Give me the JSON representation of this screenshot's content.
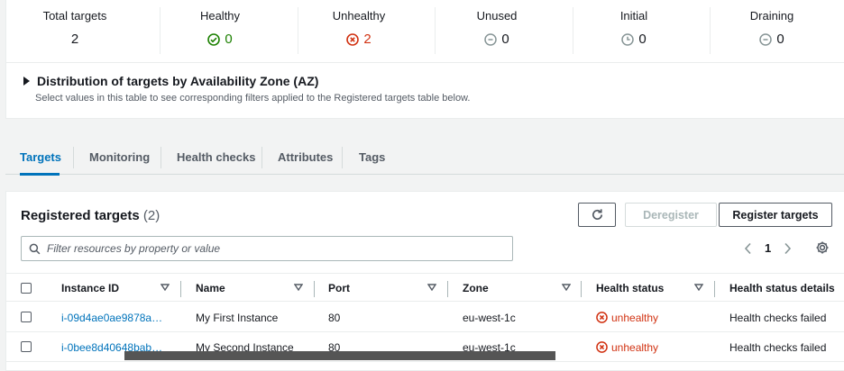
{
  "summary": {
    "total": {
      "label": "Total targets",
      "value": "2"
    },
    "healthy": {
      "label": "Healthy",
      "value": "0"
    },
    "unhealthy": {
      "label": "Unhealthy",
      "value": "2"
    },
    "unused": {
      "label": "Unused",
      "value": "0"
    },
    "initial": {
      "label": "Initial",
      "value": "0"
    },
    "draining": {
      "label": "Draining",
      "value": "0"
    }
  },
  "az": {
    "title": "Distribution of targets by Availability Zone (AZ)",
    "description": "Select values in this table to see corresponding filters applied to the Registered targets table below."
  },
  "tabs": [
    {
      "label": "Targets",
      "active": true
    },
    {
      "label": "Monitoring"
    },
    {
      "label": "Health checks"
    },
    {
      "label": "Attributes"
    },
    {
      "label": "Tags"
    }
  ],
  "registered": {
    "title": "Registered targets",
    "count": "(2)",
    "deregister_label": "Deregister",
    "register_label": "Register targets",
    "filter_placeholder": "Filter resources by property or value",
    "page": "1"
  },
  "table": {
    "columns": [
      "Instance ID",
      "Name",
      "Port",
      "Zone",
      "Health status",
      "Health status details"
    ],
    "rows": [
      {
        "instance_id": "i-09d4ae0ae9878a…",
        "name": "My First Instance",
        "port": "80",
        "zone": "eu-west-1c",
        "health": "unhealthy",
        "details": "Health checks failed"
      },
      {
        "instance_id": "i-0bee8d40648bab…",
        "name": "My Second Instance",
        "port": "80",
        "zone": "eu-west-1c",
        "health": "unhealthy",
        "details": "Health checks failed"
      }
    ]
  },
  "colors": {
    "accent": "#0073bb",
    "healthy": "#1d8102",
    "unhealthy": "#d13212"
  }
}
